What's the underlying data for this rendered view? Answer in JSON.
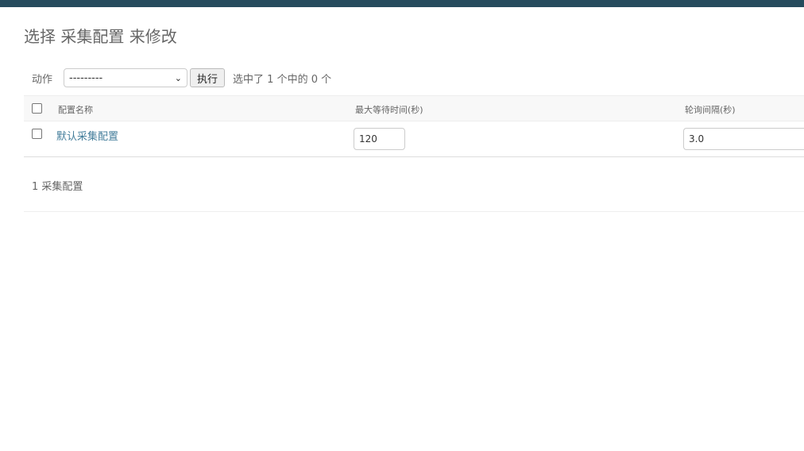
{
  "page": {
    "title": "选择 采集配置 来修改"
  },
  "actions": {
    "label": "动作",
    "select_value": "---------",
    "go_label": "执行",
    "counter": "选中了 1 个中的 0 个"
  },
  "table": {
    "columns": [
      "配置名称",
      "最大等待时间(秒)",
      "轮询间隔(秒)"
    ],
    "rows": [
      {
        "name": "默认采集配置",
        "max_wait": "120",
        "poll_interval": "3.0"
      }
    ]
  },
  "paginator": {
    "text": "1 采集配置"
  },
  "colors": {
    "header_bar": "#264b5d",
    "link": "#447e9b"
  }
}
